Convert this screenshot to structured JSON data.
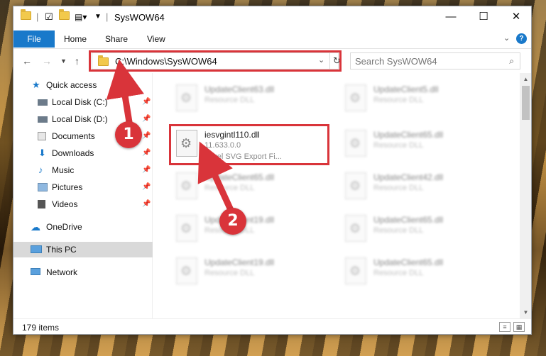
{
  "window": {
    "title": "SysWOW64",
    "controls": {
      "minimize": "—",
      "maximize": "☐",
      "close": "✕"
    }
  },
  "ribbon": {
    "tabs": [
      "File",
      "Home",
      "Share",
      "View"
    ],
    "help": "?"
  },
  "address": {
    "path": "C:\\Windows\\SysWOW64",
    "search_placeholder": "Search SysWOW64"
  },
  "nav_pane": {
    "items": [
      {
        "label": "Quick access",
        "icon": "star-icon",
        "pinned": false
      },
      {
        "label": "Local Disk (C:)",
        "icon": "drive-icon",
        "pinned": true
      },
      {
        "label": "Local Disk (D:)",
        "icon": "drive-icon",
        "pinned": true
      },
      {
        "label": "Documents",
        "icon": "documents-icon",
        "pinned": true
      },
      {
        "label": "Downloads",
        "icon": "downloads-icon",
        "pinned": true
      },
      {
        "label": "Music",
        "icon": "music-icon",
        "pinned": true
      },
      {
        "label": "Pictures",
        "icon": "pictures-icon",
        "pinned": true
      },
      {
        "label": "Videos",
        "icon": "videos-icon",
        "pinned": true
      },
      {
        "label": "OneDrive",
        "icon": "cloud-icon",
        "pinned": false
      },
      {
        "label": "This PC",
        "icon": "computer-icon",
        "pinned": false,
        "selected": true
      },
      {
        "label": "Network",
        "icon": "network-icon",
        "pinned": false
      }
    ]
  },
  "files": {
    "left_column": [
      {
        "name": "UpdateClient63.dll",
        "type": "Resource DLL"
      },
      {
        "name": "iesvgintl110.dll",
        "version": "11.633.0.0",
        "description": "Corel SVG Export Fi...",
        "highlighted": true
      },
      {
        "name": "UpdateClient65.dll",
        "type": "Resource DLL"
      },
      {
        "name": "UpdateClient19.dll",
        "type": "Resource DLL"
      },
      {
        "name": "UpdateClient19.dll",
        "type": "Resource DLL"
      }
    ],
    "right_column": [
      {
        "name": "UpdateClient5.dll",
        "type": "Resource DLL"
      },
      {
        "name": "UpdateClient65.dll",
        "type": "Resource DLL"
      },
      {
        "name": "UpdateClient42.dll",
        "type": "Resource DLL"
      },
      {
        "name": "UpdateClient65.dll",
        "type": "Resource DLL"
      },
      {
        "name": "UpdateClient65.dll",
        "type": "Resource DLL"
      }
    ]
  },
  "status": {
    "item_count": "179 items"
  },
  "annotations": {
    "step1": "1",
    "step2": "2",
    "color": "#d9343a"
  }
}
